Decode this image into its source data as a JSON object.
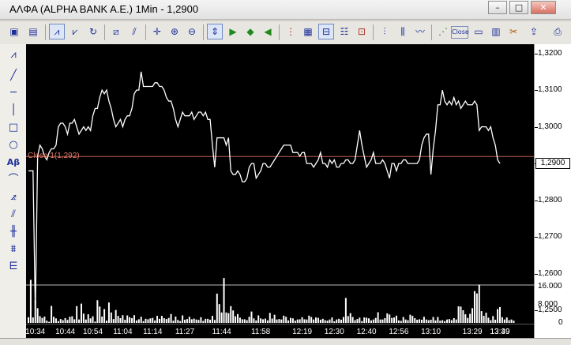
{
  "window": {
    "title": "ΑΛΦΑ (ALPHA BANK A.E.) 1Min - 1,2900",
    "buttons": {
      "minimize": "–",
      "maximize": "□",
      "close": "✕"
    }
  },
  "toolbar": {
    "close_button": "Close"
  },
  "colors": {
    "background": "#000000",
    "price_line": "#ffffff",
    "close_line": "#c0604f",
    "volume_bars": "#ffffff",
    "tool_icons": "#1c2f9a"
  },
  "indicator": {
    "close_label": "Close 1(1,292)"
  },
  "price_axis": {
    "ticks": [
      "1,3200",
      "1,3100",
      "1,3000",
      "1,2900",
      "1,2800",
      "1,2700",
      "1,2600",
      "1,2500"
    ],
    "last_value": "1,2900"
  },
  "volume_axis": {
    "ticks": [
      "16.000",
      "8.000",
      "0"
    ]
  },
  "chart_data": {
    "type": "line",
    "title": "ΑΛΦΑ (ALPHA BANK A.E.) 1Min - 1,2900",
    "xlabel": "",
    "ylabel": "",
    "ylim": [
      1.2453,
      1.3225
    ],
    "volume_ylim": [
      0,
      19500
    ],
    "close_line_value": 1.2919,
    "x_ticks": [
      "10:34",
      "10:44",
      "10:54",
      "11:04",
      "11:14",
      "11:27",
      "11:44",
      "11:58",
      "12:19",
      "12:30",
      "12:40",
      "12:56",
      "13:10",
      "13:29",
      "13:39",
      "13:49"
    ],
    "series": [
      {
        "values": [
          1.288,
          1.288,
          1.288,
          1.249,
          1.292,
          1.295,
          1.294,
          1.292,
          1.291,
          1.293,
          1.294,
          1.294,
          1.295,
          1.3,
          1.301,
          1.301,
          1.3,
          1.298,
          1.301,
          1.301,
          1.302,
          1.3,
          1.298,
          1.299,
          1.3,
          1.299,
          1.3,
          1.299,
          1.303,
          1.305,
          1.305,
          1.308,
          1.31,
          1.309,
          1.31,
          1.307,
          1.305,
          1.302,
          1.3,
          1.301,
          1.302,
          1.3,
          1.302,
          1.303,
          1.303,
          1.305,
          1.309,
          1.31,
          1.31,
          1.315,
          1.311,
          1.311,
          1.311,
          1.311,
          1.311,
          1.312,
          1.312,
          1.311,
          1.311,
          1.31,
          1.308,
          1.307,
          1.307,
          1.305,
          1.302,
          1.3,
          1.302,
          1.304,
          1.303,
          1.303,
          1.303,
          1.304,
          1.302,
          1.303,
          1.304,
          1.304,
          1.303,
          1.304,
          1.302,
          1.302,
          1.295,
          1.289,
          1.297,
          1.297,
          1.297,
          1.297,
          1.295,
          1.297,
          1.288,
          1.287,
          1.287,
          1.288,
          1.287,
          1.285,
          1.285,
          1.286,
          1.289,
          1.29,
          1.29,
          1.286,
          1.287,
          1.288,
          1.29,
          1.29,
          1.289,
          1.289,
          1.29,
          1.291,
          1.292,
          1.293,
          1.294,
          1.295,
          1.295,
          1.295,
          1.295,
          1.293,
          1.293,
          1.293,
          1.292,
          1.293,
          1.293,
          1.29,
          1.29,
          1.29,
          1.289,
          1.29,
          1.291,
          1.293,
          1.29,
          1.29,
          1.289,
          1.291,
          1.29,
          1.291,
          1.289,
          1.289,
          1.29,
          1.29,
          1.291,
          1.291,
          1.29,
          1.29,
          1.291,
          1.295,
          1.299,
          1.295,
          1.292,
          1.289,
          1.29,
          1.291,
          1.293,
          1.29,
          1.29,
          1.29,
          1.291,
          1.29,
          1.288,
          1.286,
          1.29,
          1.29,
          1.288,
          1.29,
          1.29,
          1.291,
          1.291,
          1.29,
          1.29,
          1.29,
          1.29,
          1.29,
          1.291,
          1.295,
          1.297,
          1.298,
          1.298,
          1.287,
          1.294,
          1.299,
          1.306,
          1.306,
          1.31,
          1.307,
          1.306,
          1.307,
          1.306,
          1.308,
          1.306,
          1.307,
          1.305,
          1.306,
          1.307,
          1.306,
          1.306,
          1.306,
          1.307,
          1.306,
          1.299,
          1.3,
          1.3,
          1.3,
          1.299,
          1.3,
          1.297,
          1.295,
          1.291,
          1.29
        ]
      }
    ],
    "volume_series": [
      {
        "values": [
          2500,
          19000,
          2400,
          10000,
          6500,
          3000,
          2200,
          2800,
          1000,
          500,
          7500,
          2700,
          2000,
          800,
          1700,
          1200,
          2100,
          1300,
          2700,
          2900,
          1600,
          7400,
          1500,
          8500,
          4100,
          1500,
          3800,
          2000,
          2900,
          600,
          10000,
          7200,
          2800,
          6100,
          1000,
          9000,
          4600,
          1700,
          5700,
          3100,
          2100,
          3400,
          1400,
          3300,
          2500,
          2100,
          3400,
          1100,
          1600,
          2700,
          800,
          1800,
          1600,
          2000,
          2200,
          1100,
          3100,
          1800,
          3100,
          2100,
          1700,
          2200,
          3900,
          1000,
          2800,
          1300,
          800,
          3300,
          1400,
          1700,
          2700,
          1600,
          1900,
          1500,
          1300,
          2500,
          900,
          1800,
          1800,
          1400,
          3100,
          1300,
          12900,
          8300,
          4600,
          19800,
          4600,
          4300,
          7400,
          5500,
          2900,
          3900,
          2300,
          1600,
          1600,
          1200,
          2700,
          5000,
          2000,
          1100,
          3300,
          2000,
          1600,
          1900,
          1100,
          4400,
          1900,
          3600,
          1500,
          1700,
          1500,
          3200,
          2700,
          1100,
          2200,
          2000,
          1000,
          1500,
          1600,
          2500,
          1600,
          1500,
          3200,
          2600,
          1500,
          2400,
          2200,
          1400,
          1800,
          1200,
          1000,
          1500,
          2400,
          700,
          1500,
          1800,
          1400,
          2600,
          11000,
          3000,
          4300,
          2600,
          1200,
          1700,
          2300,
          800,
          2400,
          2300,
          2000,
          1100,
          1500,
          2200,
          4700,
          1500,
          1500,
          2100,
          4200,
          3700,
          2200,
          2400,
          3200,
          1100,
          900,
          2600,
          1500,
          1200,
          3600,
          3100,
          2100,
          1400,
          1600,
          1400,
          2700,
          1500,
          1200,
          1400,
          2600,
          1100,
          2600,
          1000,
          1200,
          800,
          1500,
          1700,
          1200,
          2100,
          1500,
          7300,
          7200,
          5600,
          3800,
          2200,
          4000,
          6500,
          14000,
          13000,
          16900,
          5200,
          3100,
          4500,
          2300,
          1200,
          3000,
          1400,
          6100,
          7000,
          2500,
          1500,
          2400,
          1200,
          1500,
          1000
        ]
      }
    ]
  }
}
